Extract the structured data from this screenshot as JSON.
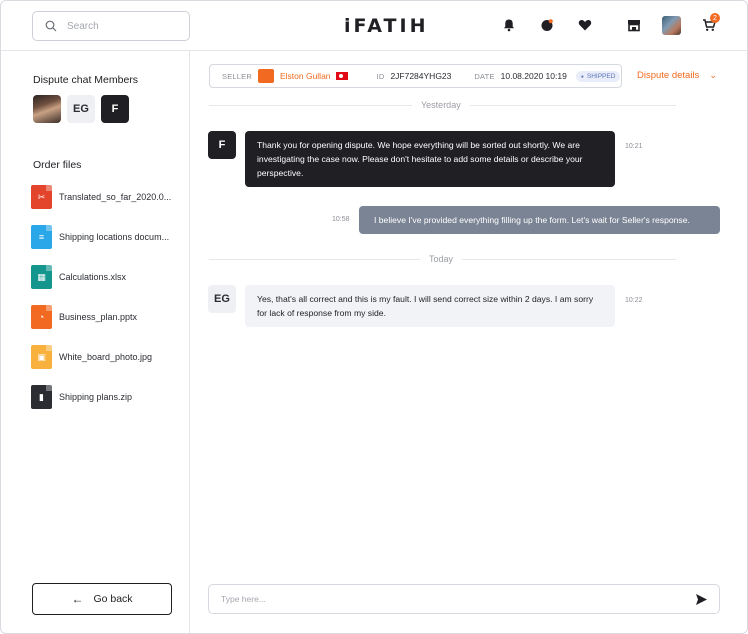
{
  "header": {
    "search_placeholder": "Search",
    "logo": "iFATIH",
    "cart_count": "2",
    "icons": [
      "bell-icon",
      "moon-icon",
      "heart-icon",
      "store-icon",
      "user-avatar",
      "cart-icon"
    ],
    "accent_color": "#f26a21"
  },
  "sidebar": {
    "members_title": "Dispute chat Members",
    "members": [
      {
        "type": "photo",
        "label": ""
      },
      {
        "type": "initials",
        "label": "EG"
      },
      {
        "type": "logo",
        "label": "F"
      }
    ],
    "files_title": "Order files",
    "files": [
      {
        "name": "Translated_so_far_2020.0...",
        "icon": "pdf-icon",
        "color": "#e2452b",
        "glyph": "✂"
      },
      {
        "name": "Shipping locations docum...",
        "icon": "doc-icon",
        "color": "#29a7e8",
        "glyph": "≡"
      },
      {
        "name": "Calculations.xlsx",
        "icon": "xlsx-icon",
        "color": "#14968f",
        "glyph": "▦"
      },
      {
        "name": "Business_plan.pptx",
        "icon": "pptx-icon",
        "color": "#f26a21",
        "glyph": "◔"
      },
      {
        "name": "White_board_photo.jpg",
        "icon": "jpg-icon",
        "color": "#f8b13d",
        "glyph": "▣"
      },
      {
        "name": "Shipping plans.zip",
        "icon": "zip-icon",
        "color": "#2b2d33",
        "glyph": "▮"
      }
    ],
    "go_back": "Go back"
  },
  "order": {
    "seller_label": "SELLER",
    "seller_name": "Elston Gullan",
    "id_label": "ID",
    "id_value": "2JF7284YHG23",
    "date_label": "DATE",
    "date_value": "10.08.2020 10:19",
    "status": "SHIPPED",
    "details_label": "Dispute details"
  },
  "chat": {
    "day1": "Yesterday",
    "day2": "Today",
    "messages": [
      {
        "from": "F",
        "text": "Thank you for opening dispute. We hope everything will be sorted out shortly. We are investigating the case now. Please don't hesitate to add some details or describe your perspective.",
        "time": "10:21"
      },
      {
        "from": "me",
        "text": "I believe I've provided everything filling up the form. Let's wait for Seller's response.",
        "time": "10:58"
      },
      {
        "from": "EG",
        "text": "Yes, that's all correct and this is my fault. I will send correct size within 2 days. I am sorry for lack of response from my side.",
        "time": "10:22"
      }
    ],
    "composer_placeholder": "Type here..."
  }
}
